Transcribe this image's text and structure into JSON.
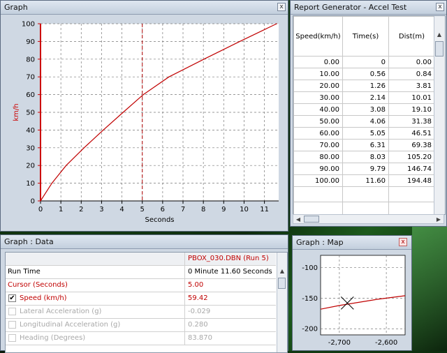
{
  "graph_window": {
    "title": "Graph",
    "close": "x"
  },
  "chart_data": [
    {
      "type": "line",
      "xlabel": "Seconds",
      "ylabel": "km/h",
      "xlim": [
        0,
        11.7
      ],
      "ylim": [
        0,
        100
      ],
      "xticks": [
        "0",
        "1",
        "2",
        "3",
        "4",
        "5",
        "6",
        "7",
        "8",
        "9",
        "10",
        "11"
      ],
      "yticks": [
        "0",
        "10",
        "20",
        "30",
        "40",
        "50",
        "60",
        "70",
        "80",
        "90",
        "100"
      ],
      "grid": true,
      "cursor_x": 5.0,
      "colors": {
        "line": "#c00000",
        "axis": "#cc0000",
        "cursor": "#b00000"
      },
      "series": [
        {
          "x": [
            0,
            0.56,
            1.26,
            2.14,
            3.08,
            4.06,
            5.05,
            6.31,
            8.03,
            9.79,
            11.6
          ],
          "y": [
            0,
            10,
            20,
            30,
            40,
            50,
            60,
            70,
            80,
            90,
            100
          ]
        }
      ]
    },
    {
      "type": "line",
      "xlim": [
        -2740,
        -2560
      ],
      "ylim": [
        -210,
        -80
      ],
      "xticks": [
        "-2,700",
        "-2,600"
      ],
      "yticks": [
        "-100",
        "-150",
        "-200"
      ],
      "grid": true,
      "marker": {
        "x": -2683,
        "y": -158
      },
      "colors": {
        "line": "#c00000"
      },
      "series": [
        {
          "x": [
            -2740,
            -2700,
            -2660,
            -2620,
            -2590,
            -2560
          ],
          "y": [
            -168,
            -162,
            -157,
            -152,
            -149,
            -146
          ]
        }
      ]
    }
  ],
  "report_window": {
    "title": "Report Generator - Accel Test",
    "close": "x",
    "columns": [
      "Speed(km/h)",
      "Time(s)",
      "Dist(m)"
    ],
    "rows": [
      [
        "0.00",
        "0",
        "0.00"
      ],
      [
        "10.00",
        "0.56",
        "0.84"
      ],
      [
        "20.00",
        "1.26",
        "3.81"
      ],
      [
        "30.00",
        "2.14",
        "10.01"
      ],
      [
        "40.00",
        "3.08",
        "19.10"
      ],
      [
        "50.00",
        "4.06",
        "31.38"
      ],
      [
        "60.00",
        "5.05",
        "46.51"
      ],
      [
        "70.00",
        "6.31",
        "69.38"
      ],
      [
        "80.00",
        "8.03",
        "105.20"
      ],
      [
        "90.00",
        "9.79",
        "146.74"
      ],
      [
        "100.00",
        "11.60",
        "194.48"
      ]
    ]
  },
  "data_window": {
    "title": "Graph : Data",
    "file_header": "PBOX_030.DBN (Run 5)",
    "rows": [
      {
        "label": "Run Time",
        "value": "0 Minute 11.60 Seconds"
      },
      {
        "label": "Cursor (Seconds)",
        "value": "5.00"
      },
      {
        "label": "Speed (km/h)",
        "value": "59.42",
        "check": "✔"
      },
      {
        "label": "Lateral Acceleration (g)",
        "value": "-0.029"
      },
      {
        "label": "Longitudinal Acceleration (g)",
        "value": "0.280"
      },
      {
        "label": "Heading (Degrees)",
        "value": "83.870"
      }
    ]
  },
  "map_window": {
    "title": "Graph : Map",
    "close": "x"
  }
}
